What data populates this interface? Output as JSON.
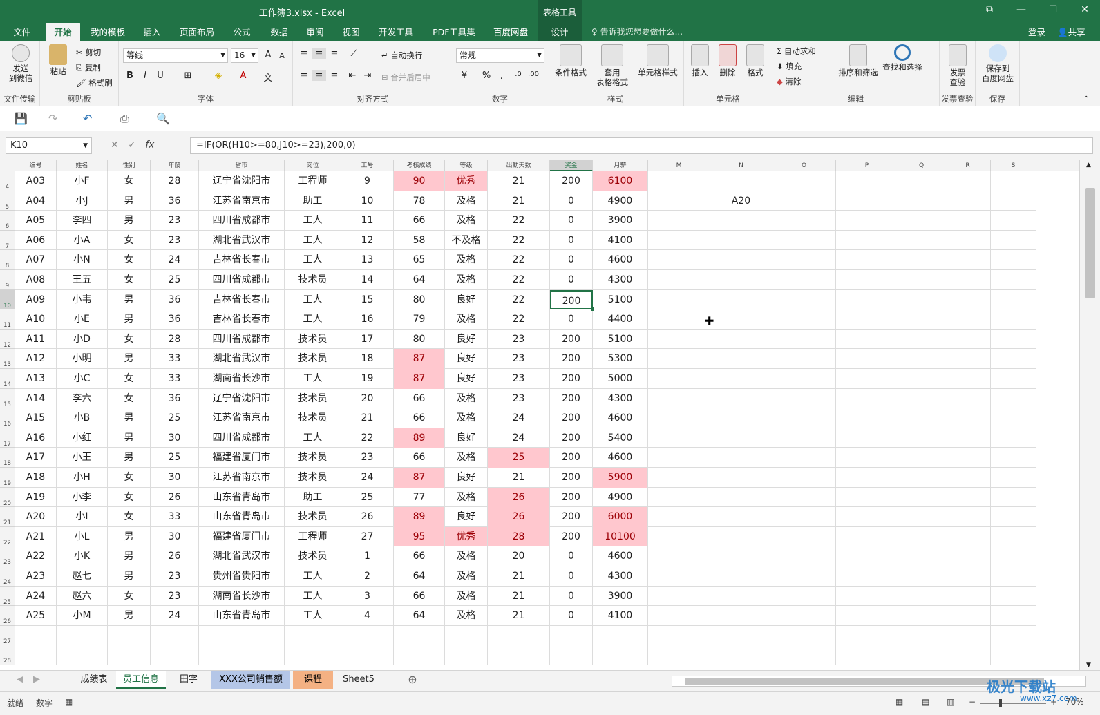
{
  "titlebar": {
    "title": "工作簿3.xlsx - Excel",
    "context_tool": "表格工具",
    "restore": "⧉",
    "minimize": "—",
    "maximize": "☐",
    "close": "✕"
  },
  "tabs": [
    {
      "label": "文件"
    },
    {
      "label": "开始"
    },
    {
      "label": "我的模板"
    },
    {
      "label": "插入"
    },
    {
      "label": "页面布局"
    },
    {
      "label": "公式"
    },
    {
      "label": "数据"
    },
    {
      "label": "审阅"
    },
    {
      "label": "视图"
    },
    {
      "label": "开发工具"
    },
    {
      "label": "PDF工具集"
    },
    {
      "label": "百度网盘"
    },
    {
      "label": "设计"
    }
  ],
  "tellme": "告诉我您想要做什么...",
  "login": "登录",
  "share": "共享",
  "ribbon": {
    "wechat": {
      "label": "发送\n到微信",
      "group": "文件传输"
    },
    "clipboard": {
      "paste": "粘贴",
      "cut": "剪切",
      "copy": "复制",
      "format_painter": "格式刷",
      "group": "剪贴板"
    },
    "font": {
      "name": "等线",
      "size": "16",
      "grow": "A",
      "shrink": "A",
      "bold": "B",
      "italic": "I",
      "underline": "U",
      "wen": "文",
      "group": "字体"
    },
    "align": {
      "wrap": "自动换行",
      "merge": "合并后居中",
      "group": "对齐方式"
    },
    "number": {
      "format": "常规",
      "percent": "%",
      "comma": ",",
      "group": "数字"
    },
    "styles": {
      "conditional": "条件格式",
      "table": "套用\n表格格式",
      "cell": "单元格样式",
      "group": "样式"
    },
    "cells": {
      "insert": "插入",
      "delete": "删除",
      "format": "格式",
      "group": "单元格"
    },
    "editing": {
      "autosum": "自动求和",
      "fill": "填充",
      "clear": "清除",
      "sort": "排序和筛选",
      "find": "查找和选择",
      "group": "编辑"
    },
    "invoice": {
      "label": "发票\n查验",
      "group": "发票查验"
    },
    "save_baidu": {
      "label": "保存到\n百度网盘",
      "group": "保存"
    }
  },
  "namebox": "K10",
  "formula": "=IF(OR(H10>=80,J10>=23),200,0)",
  "columns": [
    {
      "letter": "",
      "header": "编号"
    },
    {
      "letter": "",
      "header": "姓名"
    },
    {
      "letter": "",
      "header": "性别"
    },
    {
      "letter": "",
      "header": "年龄"
    },
    {
      "letter": "",
      "header": "省市"
    },
    {
      "letter": "",
      "header": "岗位"
    },
    {
      "letter": "",
      "header": "工号"
    },
    {
      "letter": "",
      "header": "考核成绩"
    },
    {
      "letter": "",
      "header": "等级"
    },
    {
      "letter": "",
      "header": "出勤天数"
    },
    {
      "letter": "",
      "header": "奖金"
    },
    {
      "letter": "",
      "header": "月薪"
    },
    {
      "letter": "M",
      "header": "M"
    },
    {
      "letter": "N",
      "header": "N"
    },
    {
      "letter": "O",
      "header": "O"
    },
    {
      "letter": "P",
      "header": "P"
    },
    {
      "letter": "Q",
      "header": "Q"
    },
    {
      "letter": "R",
      "header": "R"
    },
    {
      "letter": "S",
      "header": "S"
    }
  ],
  "rows": [
    {
      "n": "4",
      "cells": [
        "A03",
        "小F",
        "女",
        "28",
        "辽宁省沈阳市",
        "工程师",
        "9",
        "90",
        "优秀",
        "21",
        "200",
        "6100"
      ],
      "hl": [
        7,
        8,
        11
      ]
    },
    {
      "n": "5",
      "cells": [
        "A04",
        "小J",
        "男",
        "36",
        "江苏省南京市",
        "助工",
        "10",
        "78",
        "及格",
        "21",
        "0",
        "4900"
      ],
      "hl": [],
      "n_col": "A20"
    },
    {
      "n": "6",
      "cells": [
        "A05",
        "李四",
        "男",
        "23",
        "四川省成都市",
        "工人",
        "11",
        "66",
        "及格",
        "22",
        "0",
        "3900"
      ],
      "hl": []
    },
    {
      "n": "7",
      "cells": [
        "A06",
        "小A",
        "女",
        "23",
        "湖北省武汉市",
        "工人",
        "12",
        "58",
        "不及格",
        "22",
        "0",
        "4100"
      ],
      "hl": []
    },
    {
      "n": "8",
      "cells": [
        "A07",
        "小N",
        "女",
        "24",
        "吉林省长春市",
        "工人",
        "13",
        "65",
        "及格",
        "22",
        "0",
        "4600"
      ],
      "hl": []
    },
    {
      "n": "9",
      "cells": [
        "A08",
        "王五",
        "女",
        "25",
        "四川省成都市",
        "技术员",
        "14",
        "64",
        "及格",
        "22",
        "0",
        "4300"
      ],
      "hl": []
    },
    {
      "n": "10",
      "cells": [
        "A09",
        "小韦",
        "男",
        "36",
        "吉林省长春市",
        "工人",
        "15",
        "80",
        "良好",
        "22",
        "200",
        "5100"
      ],
      "hl": [],
      "active": 10
    },
    {
      "n": "11",
      "cells": [
        "A10",
        "小E",
        "男",
        "36",
        "吉林省长春市",
        "工人",
        "16",
        "79",
        "及格",
        "22",
        "0",
        "4400"
      ],
      "hl": []
    },
    {
      "n": "12",
      "cells": [
        "A11",
        "小D",
        "女",
        "28",
        "四川省成都市",
        "技术员",
        "17",
        "80",
        "良好",
        "23",
        "200",
        "5100"
      ],
      "hl": []
    },
    {
      "n": "13",
      "cells": [
        "A12",
        "小明",
        "男",
        "33",
        "湖北省武汉市",
        "技术员",
        "18",
        "87",
        "良好",
        "23",
        "200",
        "5300"
      ],
      "hl": [
        7
      ]
    },
    {
      "n": "14",
      "cells": [
        "A13",
        "小C",
        "女",
        "33",
        "湖南省长沙市",
        "工人",
        "19",
        "87",
        "良好",
        "23",
        "200",
        "5000"
      ],
      "hl": [
        7
      ]
    },
    {
      "n": "15",
      "cells": [
        "A14",
        "李六",
        "女",
        "36",
        "辽宁省沈阳市",
        "技术员",
        "20",
        "66",
        "及格",
        "23",
        "200",
        "4300"
      ],
      "hl": []
    },
    {
      "n": "16",
      "cells": [
        "A15",
        "小B",
        "男",
        "25",
        "江苏省南京市",
        "技术员",
        "21",
        "66",
        "及格",
        "24",
        "200",
        "4600"
      ],
      "hl": []
    },
    {
      "n": "17",
      "cells": [
        "A16",
        "小红",
        "男",
        "30",
        "四川省成都市",
        "工人",
        "22",
        "89",
        "良好",
        "24",
        "200",
        "5400"
      ],
      "hl": [
        7
      ]
    },
    {
      "n": "18",
      "cells": [
        "A17",
        "小王",
        "男",
        "25",
        "福建省厦门市",
        "技术员",
        "23",
        "66",
        "及格",
        "25",
        "200",
        "4600"
      ],
      "hl": [
        9
      ]
    },
    {
      "n": "19",
      "cells": [
        "A18",
        "小H",
        "女",
        "30",
        "江苏省南京市",
        "技术员",
        "24",
        "87",
        "良好",
        "21",
        "200",
        "5900"
      ],
      "hl": [
        7,
        11
      ]
    },
    {
      "n": "20",
      "cells": [
        "A19",
        "小李",
        "女",
        "26",
        "山东省青岛市",
        "助工",
        "25",
        "77",
        "及格",
        "26",
        "200",
        "4900"
      ],
      "hl": [
        9
      ]
    },
    {
      "n": "21",
      "cells": [
        "A20",
        "小I",
        "女",
        "33",
        "山东省青岛市",
        "技术员",
        "26",
        "89",
        "良好",
        "26",
        "200",
        "6000"
      ],
      "hl": [
        7,
        9,
        11
      ]
    },
    {
      "n": "22",
      "cells": [
        "A21",
        "小L",
        "男",
        "30",
        "福建省厦门市",
        "工程师",
        "27",
        "95",
        "优秀",
        "28",
        "200",
        "10100"
      ],
      "hl": [
        7,
        8,
        9,
        11
      ]
    },
    {
      "n": "23",
      "cells": [
        "A22",
        "小K",
        "男",
        "26",
        "湖北省武汉市",
        "技术员",
        "1",
        "66",
        "及格",
        "20",
        "0",
        "4600"
      ],
      "hl": []
    },
    {
      "n": "24",
      "cells": [
        "A23",
        "赵七",
        "男",
        "23",
        "贵州省贵阳市",
        "工人",
        "2",
        "64",
        "及格",
        "21",
        "0",
        "4300"
      ],
      "hl": []
    },
    {
      "n": "25",
      "cells": [
        "A24",
        "赵六",
        "女",
        "23",
        "湖南省长沙市",
        "工人",
        "3",
        "66",
        "及格",
        "21",
        "0",
        "3900"
      ],
      "hl": []
    },
    {
      "n": "26",
      "cells": [
        "A25",
        "小M",
        "男",
        "24",
        "山东省青岛市",
        "工人",
        "4",
        "64",
        "及格",
        "21",
        "0",
        "4100"
      ],
      "hl": []
    },
    {
      "n": "27",
      "cells": [
        "",
        "",
        "",
        "",
        "",
        "",
        "",
        "",
        "",
        "",
        "",
        ""
      ],
      "hl": []
    },
    {
      "n": "28",
      "cells": [
        "",
        "",
        "",
        "",
        "",
        "",
        "",
        "",
        "",
        "",
        "",
        ""
      ],
      "hl": []
    }
  ],
  "sheets": [
    {
      "label": "成绩表",
      "style": ""
    },
    {
      "label": "员工信息",
      "style": "active"
    },
    {
      "label": "田字格",
      "style": ""
    },
    {
      "label": "XXX公司销售额",
      "style": "blue"
    },
    {
      "label": "课程表",
      "style": "orange"
    },
    {
      "label": "Sheet5",
      "style": ""
    }
  ],
  "add_sheet": "⊕",
  "status": {
    "ready": "就绪",
    "mode": "数字",
    "zoom": "70%"
  },
  "watermark": {
    "main": "极光下载站",
    "sub": "www.xz7.com"
  },
  "colors": {
    "accent": "#217346",
    "highlight_bg": "#ffc7ce",
    "highlight_fg": "#9c0006"
  }
}
